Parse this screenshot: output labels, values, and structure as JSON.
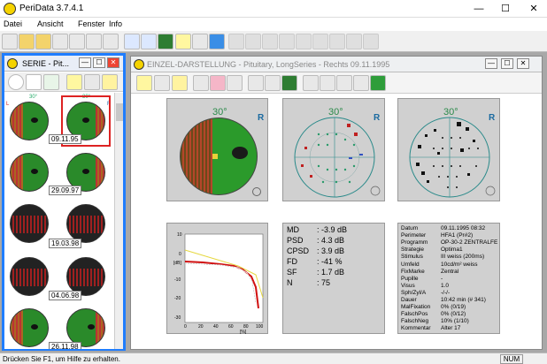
{
  "app": {
    "title": "PeriData 3.7.4.1"
  },
  "menu": [
    "Datei",
    "Ansicht",
    "Fenster",
    "Info"
  ],
  "window_controls": {
    "min": "—",
    "max": "☐",
    "close": "✕"
  },
  "series_window": {
    "title": "SERIE - Pit...",
    "dates": [
      "09.11.95",
      "29.09.97",
      "19.03.98",
      "04.06.98",
      "26.11.98"
    ],
    "labels": {
      "deg": "30°",
      "l": "L",
      "r": "R"
    }
  },
  "main_window": {
    "title": "EINZEL-DARSTELLUNG - Pituitary, LongSeries - Rechts 09.11.1995"
  },
  "plots": {
    "deg": "30°",
    "eye": "R"
  },
  "stats": {
    "md_label": "MD",
    "md": ": -3.9 dB",
    "psd_label": "PSD",
    "psd": ": 4.3 dB",
    "cpsd_label": "CPSD",
    "cpsd": ": 3.9 dB",
    "fd_label": "FD",
    "fd": ": -41 %",
    "sf_label": "SF",
    "sf": ": 1.7 dB",
    "n_label": "N",
    "n": ": 75"
  },
  "info": [
    [
      "Datum",
      "09.11.1995 08:32"
    ],
    [
      "Perimeter",
      "HFA1 (Pr#2)"
    ],
    [
      "Programm",
      "OP-30-2 ZENTRALFE"
    ],
    [
      "Strategie",
      "Optima1"
    ],
    [
      "Stimulus",
      "III weiss (200ms)"
    ],
    [
      "Umfeld",
      "10cd/m² weiss"
    ],
    [
      "FixMarke",
      "Zentral"
    ],
    [
      "Pupille",
      "-"
    ],
    [
      "Visus",
      "1.0"
    ],
    [
      "Sph/Zyl/A",
      "-/-/-"
    ],
    [
      "Dauer",
      "10:42 min (# 341)"
    ],
    [
      "MalFixation",
      "0% (0/19)"
    ],
    [
      "FalschPos",
      "0% (0/12)"
    ],
    [
      "FalschNeg",
      "10% (1/10)"
    ],
    [
      "Kommentar",
      "Alter 17"
    ]
  ],
  "curve": {
    "ylabels": [
      "10",
      "0",
      "[dB]",
      "-10",
      "-20",
      "-30"
    ],
    "xlabels": [
      "0",
      "20",
      "40",
      "60",
      "80",
      "100"
    ],
    "xunit": "[%]"
  },
  "status": {
    "text": "Drücken Sie F1, um Hilfe zu erhalten.",
    "num": "NUM"
  }
}
